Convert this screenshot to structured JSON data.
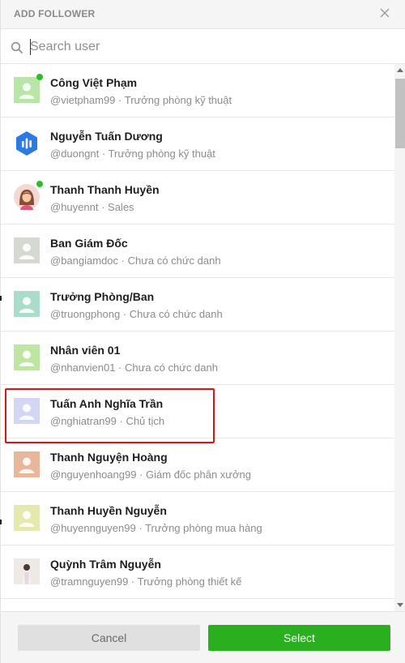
{
  "dialog": {
    "title": "ADD FOLLOWER"
  },
  "search": {
    "placeholder": "Search user",
    "value": ""
  },
  "users": [
    {
      "name": "Công Việt Phạm",
      "handle": "@vietpham99",
      "role": "Trưởng phòng kỹ thuật",
      "online": true,
      "avatar": "person-placeholder",
      "avatar_color": "#b8e6a6"
    },
    {
      "name": "Nguyễn Tuấn Dương",
      "handle": "@duongnt",
      "role": "Trưởng phòng kỹ thuật",
      "online": false,
      "avatar": "hexagon-logo",
      "avatar_color": "#2c7be5"
    },
    {
      "name": "Thanh Thanh Huyền",
      "handle": "@huyennt",
      "role": "Sales",
      "online": true,
      "avatar": "woman-illustration",
      "avatar_color": "#f3d9d4"
    },
    {
      "name": "Ban Giám Đốc",
      "handle": "@bangiamdoc",
      "role": "Chưa có chức danh",
      "online": false,
      "avatar": "person-placeholder",
      "avatar_color": "#d6d8d2"
    },
    {
      "name": "Trưởng Phòng/Ban",
      "handle": "@truongphong",
      "role": "Chưa có chức danh",
      "online": false,
      "avatar": "person-placeholder",
      "avatar_color": "#a9dcc9"
    },
    {
      "name": "Nhân viên 01",
      "handle": "@nhanvien01",
      "role": "Chưa có chức danh",
      "online": false,
      "avatar": "person-placeholder",
      "avatar_color": "#bfe5a2"
    },
    {
      "name": "Tuấn Anh Nghĩa Trần",
      "handle": "@nghiatran99",
      "role": "Chủ tịch",
      "online": false,
      "avatar": "person-placeholder",
      "avatar_color": "#d3d7f3"
    },
    {
      "name": "Thanh Nguyện Hoàng",
      "handle": "@nguyenhoang99",
      "role": "Giám đốc phân xưởng",
      "online": false,
      "avatar": "person-placeholder",
      "avatar_color": "#e8b79a"
    },
    {
      "name": "Thanh Huyền Nguyễn",
      "handle": "@huyennguyen99",
      "role": "Trưởng phòng mua hàng",
      "online": false,
      "avatar": "person-placeholder",
      "avatar_color": "#e6e9ad"
    },
    {
      "name": "Quỳnh Trâm Nguyễn",
      "handle": "@tramnguyen99",
      "role": "Trưởng phòng thiết kế",
      "online": false,
      "avatar": "photo",
      "avatar_color": "#d9d3cf"
    }
  ],
  "meta_separator": " · ",
  "highlighted_index": 6,
  "footer": {
    "cancel_label": "Cancel",
    "select_label": "Select"
  },
  "colors": {
    "online": "#2fbd27",
    "select_button": "#2aaf1f",
    "highlight_border": "#d9141b"
  }
}
